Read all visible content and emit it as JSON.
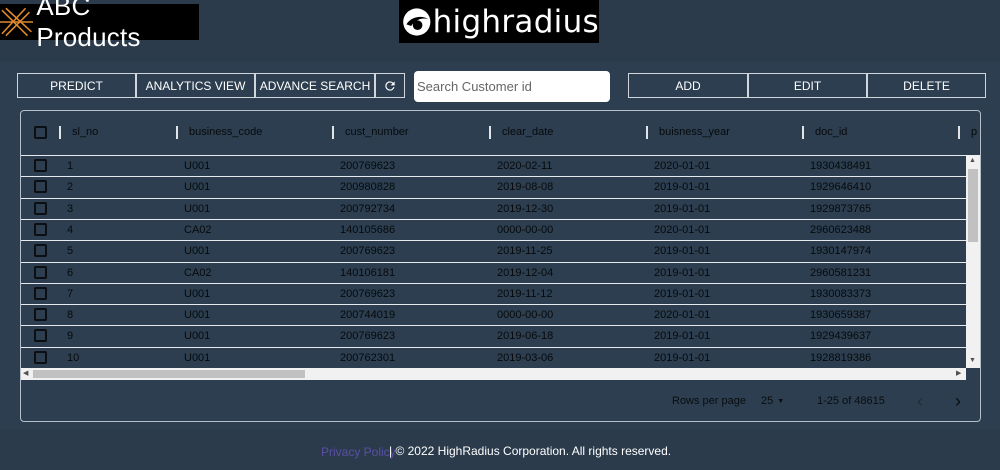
{
  "header": {
    "brand_name": "ABC Products",
    "partner_logo_text": "highradius"
  },
  "toolbar": {
    "predict_label": "PREDICT",
    "analytics_label": "ANALYTICS VIEW",
    "advance_search_label": "ADVANCE SEARCH",
    "refresh_icon": "refresh-icon",
    "search_placeholder": "Search Customer id",
    "add_label": "ADD",
    "edit_label": "EDIT",
    "delete_label": "DELETE"
  },
  "table": {
    "columns": [
      "sl_no",
      "business_code",
      "cust_number",
      "clear_date",
      "buisness_year",
      "doc_id",
      "p"
    ],
    "rows": [
      [
        "1",
        "U001",
        "200769623",
        "2020-02-11",
        "2020-01-01",
        "1930438491"
      ],
      [
        "2",
        "U001",
        "200980828",
        "2019-08-08",
        "2019-01-01",
        "1929646410"
      ],
      [
        "3",
        "U001",
        "200792734",
        "2019-12-30",
        "2019-01-01",
        "1929873765"
      ],
      [
        "4",
        "CA02",
        "140105686",
        "0000-00-00",
        "2020-01-01",
        "2960623488"
      ],
      [
        "5",
        "U001",
        "200769623",
        "2019-11-25",
        "2019-01-01",
        "1930147974"
      ],
      [
        "6",
        "CA02",
        "140106181",
        "2019-12-04",
        "2019-01-01",
        "2960581231"
      ],
      [
        "7",
        "U001",
        "200769623",
        "2019-11-12",
        "2019-01-01",
        "1930083373"
      ],
      [
        "8",
        "U001",
        "200744019",
        "0000-00-00",
        "2020-01-01",
        "1930659387"
      ],
      [
        "9",
        "U001",
        "200769623",
        "2019-06-18",
        "2019-01-01",
        "1929439637"
      ],
      [
        "10",
        "U001",
        "200762301",
        "2019-03-06",
        "2019-01-01",
        "1928819386"
      ]
    ]
  },
  "pagination": {
    "rows_per_page_label": "Rows per page",
    "rows_per_page_value": "25",
    "range_text": "1-25 of 48615"
  },
  "footer": {
    "link_text": "Privacy Policy",
    "copyright": "| © 2022 HighRadius Corporation. All rights reserved."
  },
  "colors": {
    "background": "#2c3e4f",
    "grid_background": "#2c3e4f",
    "footer_link": "#5a4ea8"
  }
}
